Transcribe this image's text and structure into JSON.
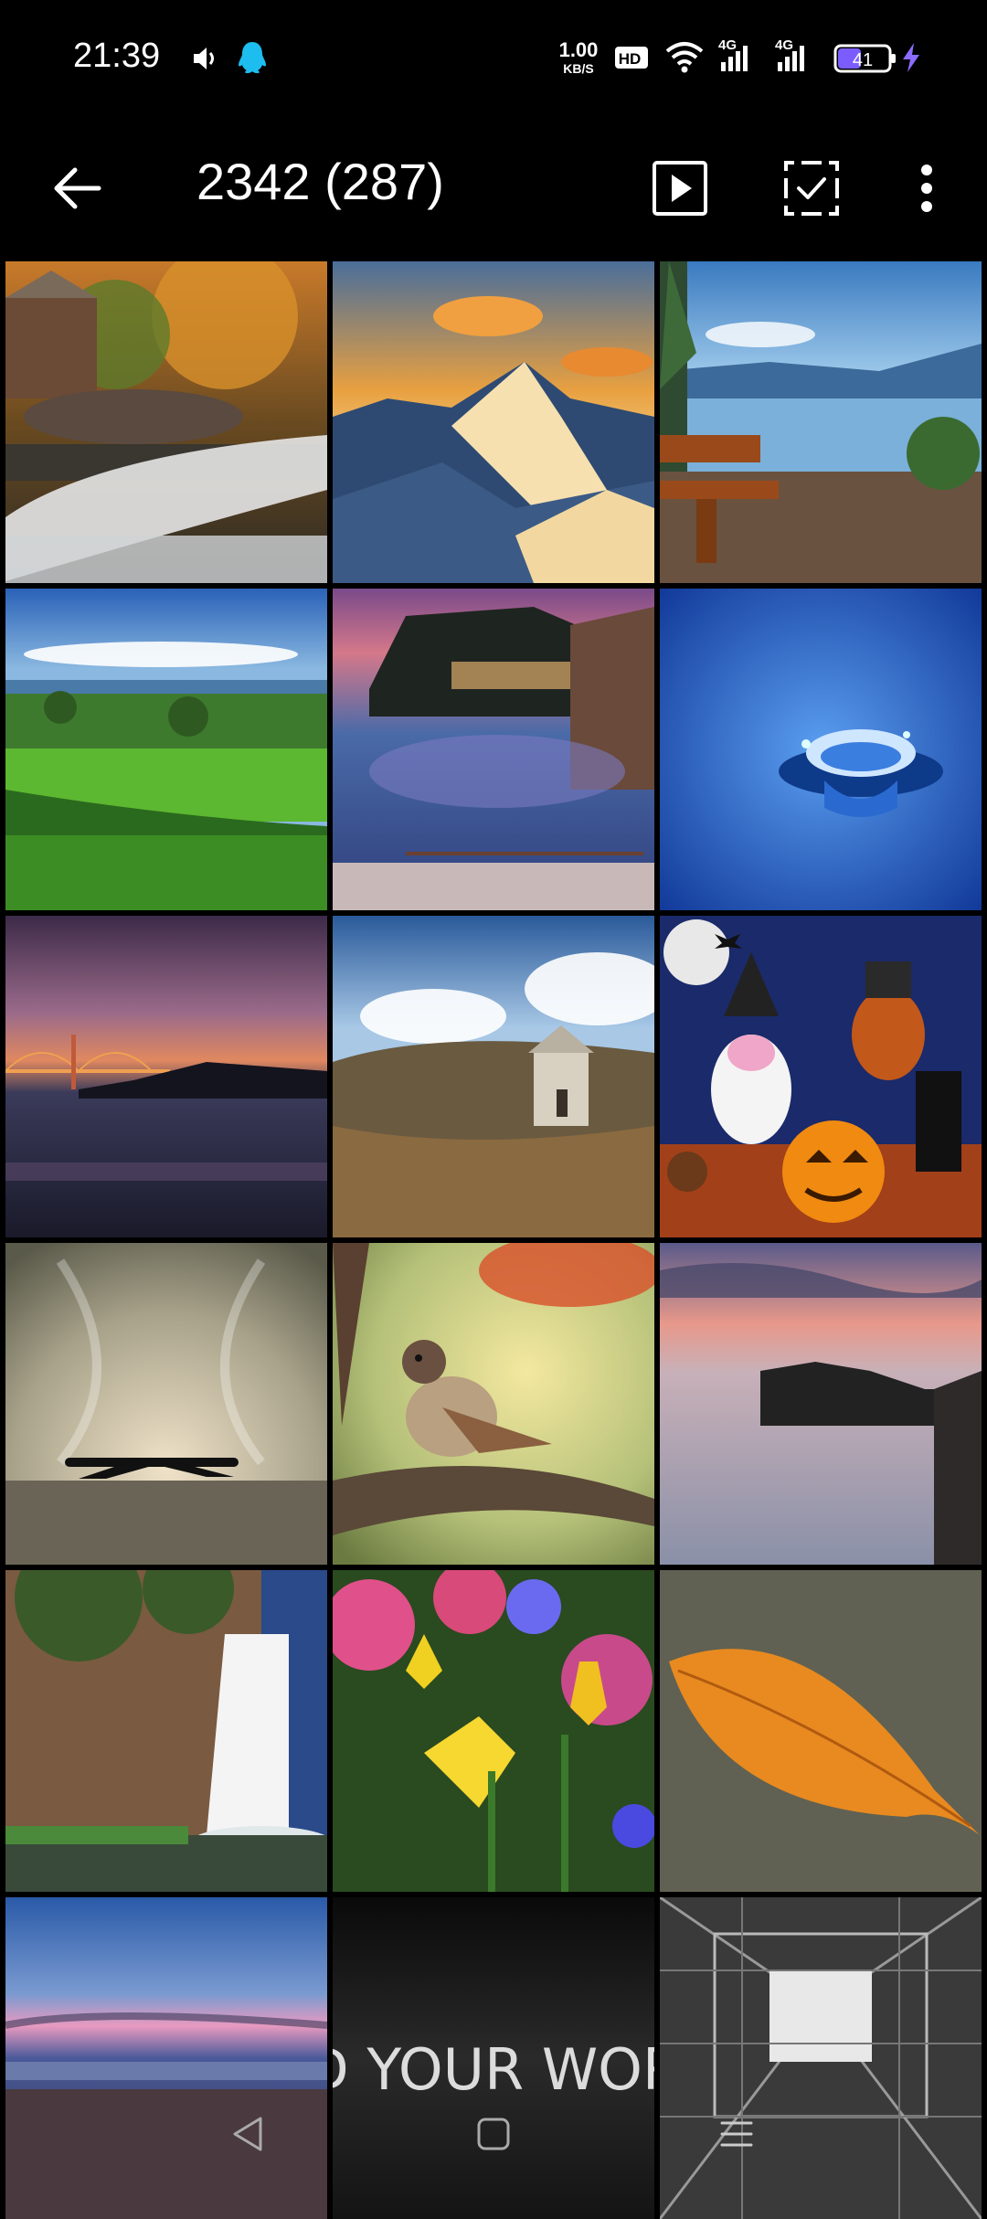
{
  "status_bar": {
    "time": "21:39",
    "net_speed_value": "1.00",
    "net_speed_unit": "KB/S",
    "hd_badge": "HD",
    "network_1": "4G",
    "network_2": "4G",
    "battery": "41",
    "icons": [
      "volume-icon",
      "qq-icon",
      "hd-icon",
      "wifi-icon",
      "signal-icon",
      "signal-icon",
      "battery-icon",
      "charging-icon"
    ]
  },
  "app_bar": {
    "title": "2342 (287)",
    "icons": [
      "back-arrow-icon",
      "slideshow-icon",
      "select-icon",
      "more-icon"
    ]
  },
  "grid": {
    "photos": [
      {
        "subject": "mill-waterfall"
      },
      {
        "subject": "snowy-mountain"
      },
      {
        "subject": "lake-bench"
      },
      {
        "subject": "green-fields"
      },
      {
        "subject": "coastal-town"
      },
      {
        "subject": "water-drop"
      },
      {
        "subject": "golden-gate"
      },
      {
        "subject": "hill-chapel"
      },
      {
        "subject": "halloween-cartoon"
      },
      {
        "subject": "airplane-storm"
      },
      {
        "subject": "sparrow"
      },
      {
        "subject": "rocky-sea"
      },
      {
        "subject": "cliff-waterfall"
      },
      {
        "subject": "flowers"
      },
      {
        "subject": "autumn-leaf"
      },
      {
        "subject": "beach-sunset"
      },
      {
        "subject": "text-wallpaper",
        "text": "D YOUR WOR"
      },
      {
        "subject": "glass-building"
      }
    ]
  },
  "nav_bar": {
    "icons": [
      "back-triangle-icon",
      "home-square-icon",
      "recents-lines-icon"
    ]
  }
}
